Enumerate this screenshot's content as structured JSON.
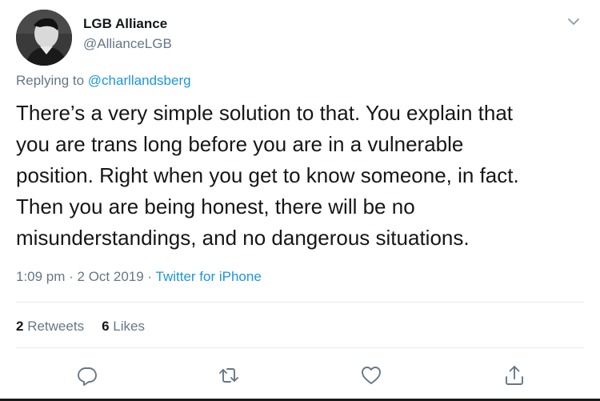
{
  "tweet": {
    "author": {
      "display_name": "LGB Alliance",
      "handle": "@AllianceLGB"
    },
    "reply_context": {
      "prefix": "Replying to",
      "mention": "@charllandsberg"
    },
    "text_lines": [
      "There’s a very simple solution to that. You explain that",
      "you are trans long before you are in a vulnerable",
      "position. Right when you get to know someone, in fact.",
      "Then you are being honest, there will be no",
      "misunderstandings, and no dangerous situations."
    ],
    "timestamp": "1:09 pm · 2 Oct 2019 ·",
    "source": "Twitter for iPhone",
    "stats": {
      "retweets_count": "2",
      "retweets_label": "Retweets",
      "likes_count": "6",
      "likes_label": "Likes"
    },
    "icons": {
      "menu": "chevron-down-icon",
      "reply": "reply-icon",
      "retweet": "retweet-icon",
      "like": "heart-icon",
      "share": "share-icon"
    },
    "colors": {
      "text": "#14171a",
      "secondary": "#657786",
      "link": "#1b95e0",
      "divider": "#e6ecf0"
    }
  }
}
